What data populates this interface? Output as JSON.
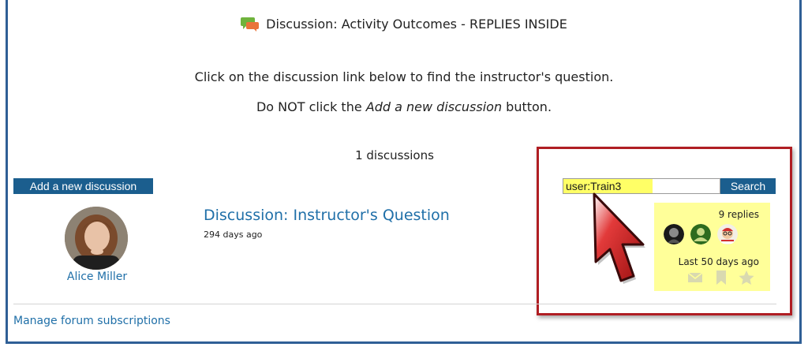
{
  "header": {
    "title": "Discussion: Activity Outcomes - REPLIES INSIDE",
    "icon": "forum-discussion-icon"
  },
  "intro": {
    "line1": "Click on the discussion link below to find the instructor's question.",
    "line2_prefix": "Do NOT click the ",
    "line2_emph": "Add a new discussion",
    "line2_suffix": " button."
  },
  "discussions": {
    "count_label": "1 discussions",
    "add_button_label": "Add a new discussion"
  },
  "search": {
    "value": "user:Train3",
    "button_label": "Search"
  },
  "post": {
    "author": "Alice Miller",
    "title": "Discussion: Instructor's Question",
    "time": "294 days ago",
    "replies": "9 replies",
    "last": "Last 50 days ago",
    "action_icons": [
      "envelope-icon",
      "bookmark-icon",
      "star-icon"
    ]
  },
  "footer": {
    "manage_link": "Manage forum subscriptions"
  },
  "colors": {
    "link": "#1f6fa8",
    "button_bg": "#1b5e8e",
    "highlight_yellow": "#ffff99",
    "callout_red": "#b01e23",
    "frame_blue": "#2f5f96"
  }
}
